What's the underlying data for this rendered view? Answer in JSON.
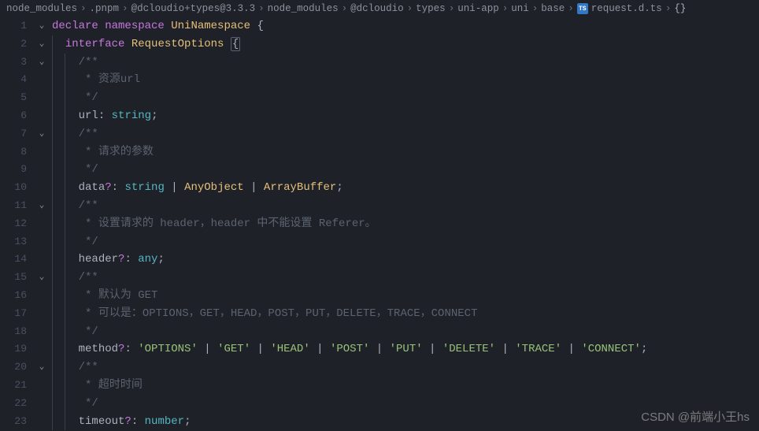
{
  "breadcrumb": {
    "items": [
      "node_modules",
      ".pnpm",
      "@dcloudio+types@3.3.3",
      "node_modules",
      "@dcloudio",
      "types",
      "uni-app",
      "uni",
      "base"
    ],
    "file": "request.d.ts",
    "symbol_icon": "{}"
  },
  "fold": {
    "l1": "⌄",
    "l2": "⌄",
    "l3": "⌄",
    "l7": "⌄",
    "l11": "⌄",
    "l15": "⌄",
    "l20": "⌄"
  },
  "code": {
    "l1": {
      "declare": "declare",
      "namespace": "namespace",
      "name": "UniNamespace",
      "brace": "{"
    },
    "l2": {
      "interface": "interface",
      "name": "RequestOptions",
      "brace": "{"
    },
    "l3": "/**",
    "l4": " * 资源url",
    "l5": " */",
    "l6": {
      "prop": "url",
      "colon": ":",
      "type": "string",
      "semi": ";"
    },
    "l7": "/**",
    "l8": " * 请求的参数",
    "l9": " */",
    "l10": {
      "prop": "data",
      "opt": "?",
      "colon": ":",
      "t1": "string",
      "pipe1": " | ",
      "t2": "AnyObject",
      "pipe2": " | ",
      "t3": "ArrayBuffer",
      "semi": ";"
    },
    "l11": "/**",
    "l12": " * 设置请求的 header，header 中不能设置 Referer。",
    "l13": " */",
    "l14": {
      "prop": "header",
      "opt": "?",
      "colon": ":",
      "type": "any",
      "semi": ";"
    },
    "l15": "/**",
    "l16": " * 默认为 GET",
    "l17": " * 可以是：OPTIONS，GET，HEAD，POST，PUT，DELETE，TRACE，CONNECT",
    "l18": " */",
    "l19": {
      "prop": "method",
      "opt": "?",
      "colon": ":",
      "v1": "'OPTIONS'",
      "v2": "'GET'",
      "v3": "'HEAD'",
      "v4": "'POST'",
      "v5": "'PUT'",
      "v6": "'DELETE'",
      "v7": "'TRACE'",
      "v8": "'CONNECT'",
      "pipe": " | ",
      "semi": ";"
    },
    "l20": "/**",
    "l21": " * 超时时间",
    "l22": " */",
    "l23": {
      "prop": "timeout",
      "opt": "?",
      "colon": ":",
      "type": "number",
      "semi": ";"
    }
  },
  "watermark": "CSDN @前端小王hs"
}
